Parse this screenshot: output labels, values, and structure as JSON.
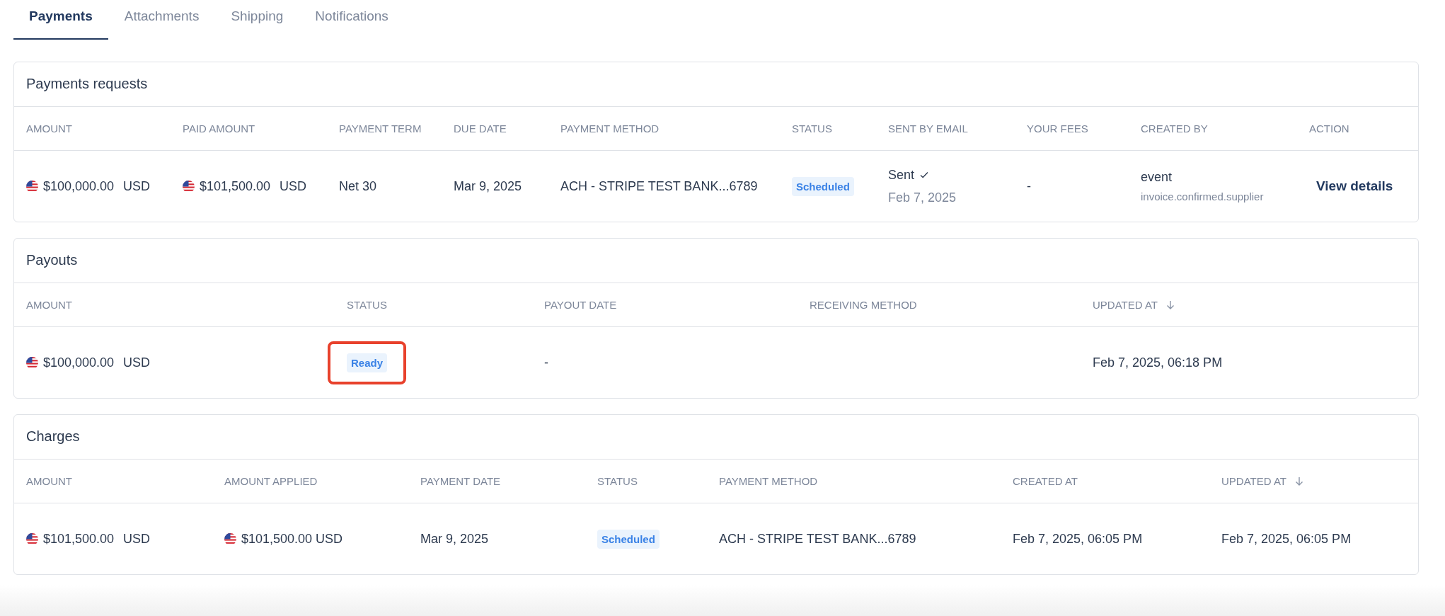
{
  "tabs": [
    {
      "label": "Payments",
      "selected": true
    },
    {
      "label": "Attachments",
      "selected": false
    },
    {
      "label": "Shipping",
      "selected": false
    },
    {
      "label": "Notifications",
      "selected": false
    }
  ],
  "sections": [
    {
      "title": "Payments requests",
      "columns": [
        {
          "label": "AMOUNT",
          "sorted": false
        },
        {
          "label": "PAID AMOUNT",
          "sorted": false
        },
        {
          "label": "PAYMENT TERM",
          "sorted": false
        },
        {
          "label": "DUE DATE",
          "sorted": false
        },
        {
          "label": "PAYMENT METHOD",
          "sorted": false
        },
        {
          "label": "STATUS",
          "sorted": false
        },
        {
          "label": "SENT BY EMAIL",
          "sorted": false
        },
        {
          "label": "YOUR FEES",
          "sorted": false
        },
        {
          "label": "CREATED BY",
          "sorted": false
        },
        {
          "label": "ACTION",
          "sorted": false
        }
      ],
      "rows": [
        [
          {
            "kind": "money",
            "amount": "$100,000.00",
            "currency": "USD"
          },
          {
            "kind": "money",
            "amount": "$101,500.00",
            "currency": "USD"
          },
          {
            "kind": "text",
            "text": "Net 30"
          },
          {
            "kind": "text",
            "text": "Mar 9, 2025"
          },
          {
            "kind": "text",
            "text": "ACH - STRIPE TEST BANK...6789"
          },
          {
            "kind": "badge",
            "text": "Scheduled",
            "highlighted": false
          },
          {
            "kind": "sent",
            "text": "Sent",
            "checked": true,
            "date": "Feb 7, 2025"
          },
          {
            "kind": "text",
            "text": "-"
          },
          {
            "kind": "creator",
            "text": "event",
            "sub": "invoice.confirmed.supplier"
          },
          {
            "kind": "link",
            "text": "View details"
          }
        ]
      ]
    },
    {
      "title": "Payouts",
      "columns": [
        {
          "label": "AMOUNT",
          "sorted": false
        },
        {
          "label": "STATUS",
          "sorted": false
        },
        {
          "label": "PAYOUT DATE",
          "sorted": false
        },
        {
          "label": "RECEIVING METHOD",
          "sorted": false
        },
        {
          "label": "UPDATED AT",
          "sorted": true
        }
      ],
      "rows": [
        [
          {
            "kind": "money",
            "amount": "$100,000.00",
            "currency": "USD"
          },
          {
            "kind": "badge",
            "text": "Ready",
            "highlighted": true
          },
          {
            "kind": "text",
            "text": "-"
          },
          {
            "kind": "empty"
          },
          {
            "kind": "text",
            "text": "Feb 7, 2025, 06:18 PM"
          }
        ]
      ]
    },
    {
      "title": "Charges",
      "columns": [
        {
          "label": "AMOUNT",
          "sorted": false
        },
        {
          "label": "AMOUNT APPLIED",
          "sorted": false
        },
        {
          "label": "PAYMENT DATE",
          "sorted": false
        },
        {
          "label": "STATUS",
          "sorted": false
        },
        {
          "label": "PAYMENT METHOD",
          "sorted": false
        },
        {
          "label": "CREATED AT",
          "sorted": false
        },
        {
          "label": "UPDATED AT",
          "sorted": true
        }
      ],
      "rows": [
        [
          {
            "kind": "money",
            "amount": "$101,500.00",
            "currency": "USD"
          },
          {
            "kind": "money",
            "amount": "$101,500.00 USD"
          },
          {
            "kind": "text",
            "text": "Mar 9, 2025"
          },
          {
            "kind": "badge",
            "text": "Scheduled",
            "highlighted": false
          },
          {
            "kind": "text",
            "text": "ACH - STRIPE TEST BANK...6789"
          },
          {
            "kind": "text",
            "text": "Feb 7, 2025, 06:05 PM"
          },
          {
            "kind": "text",
            "text": "Feb 7, 2025, 06:05 PM"
          }
        ]
      ]
    }
  ]
}
